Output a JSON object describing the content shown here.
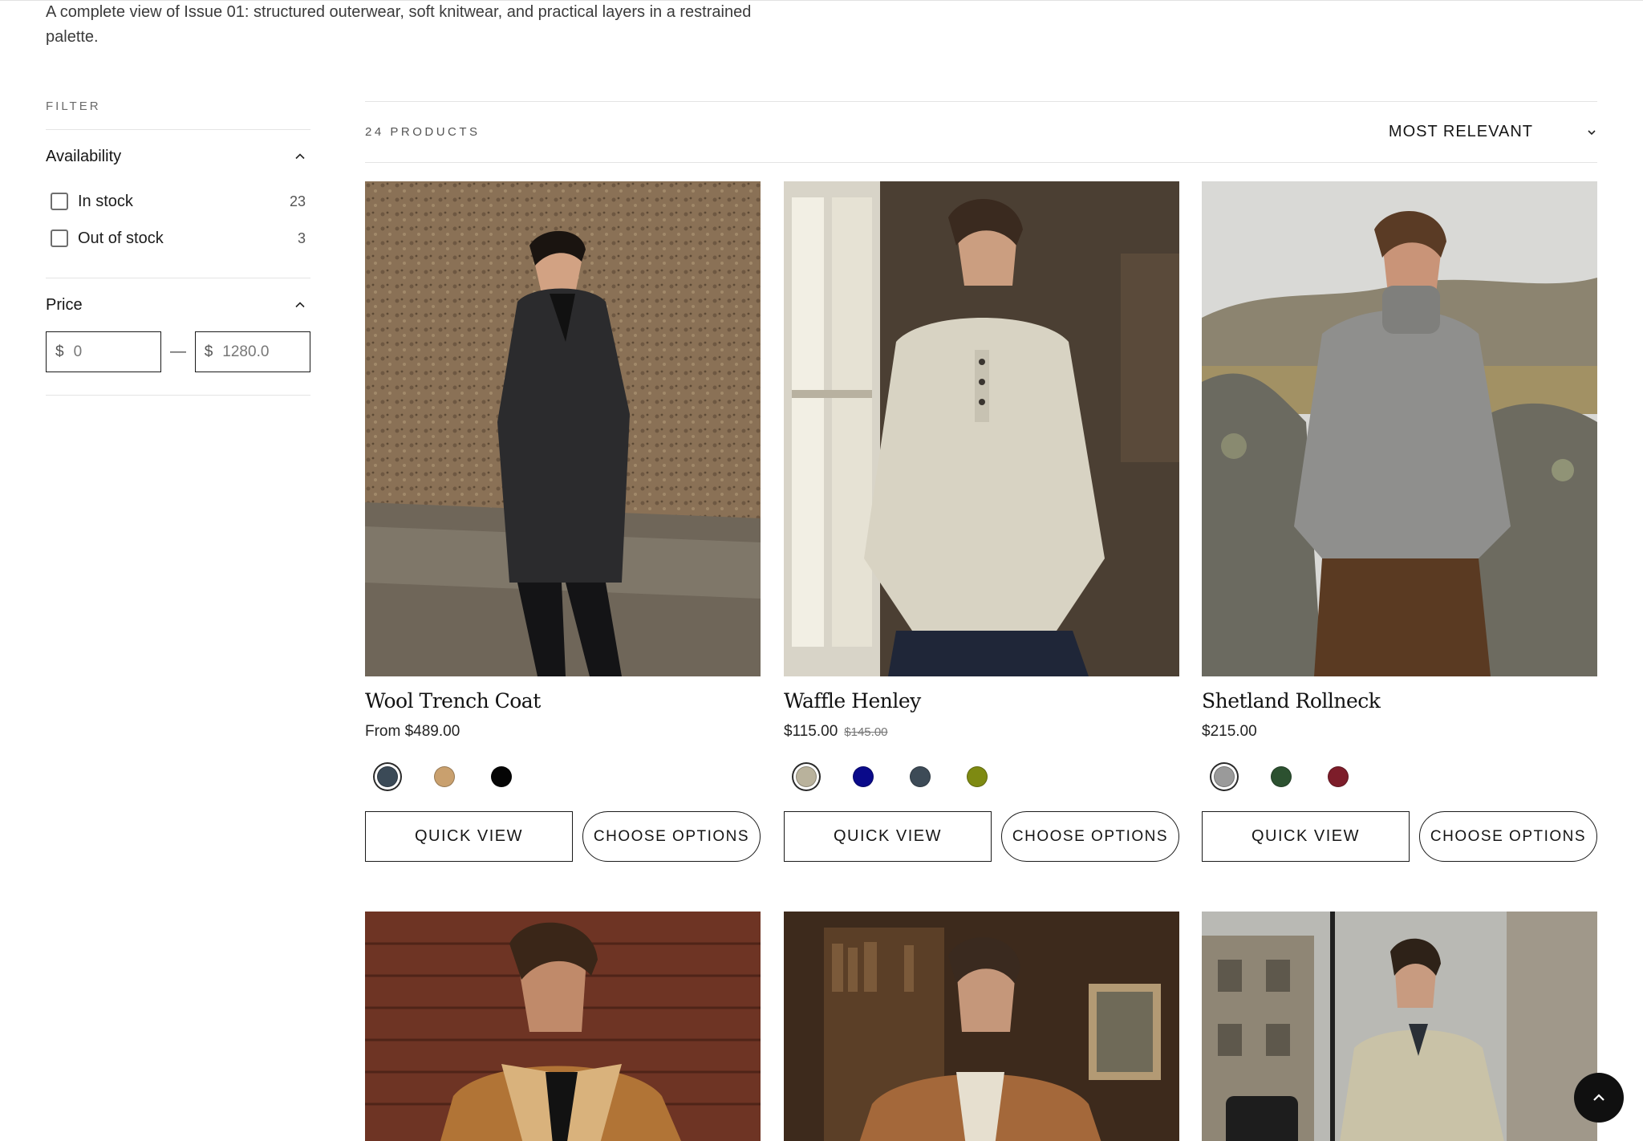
{
  "intro": {
    "text": "A complete view of Issue 01: structured outerwear, soft knitwear, and practical layers in a restrained palette."
  },
  "filter": {
    "title": "FILTER",
    "availability": {
      "label": "Availability",
      "options": [
        {
          "label": "In stock",
          "count": "23",
          "checked": false
        },
        {
          "label": "Out of stock",
          "count": "3",
          "checked": false
        }
      ]
    },
    "price": {
      "label": "Price",
      "currency": "$",
      "min_placeholder": "0",
      "max_placeholder": "1280.0",
      "separator": "—"
    }
  },
  "toolbar": {
    "count": "24 PRODUCTS",
    "sort_label": "MOST RELEVANT"
  },
  "products": [
    {
      "name": "Wool Trench Coat",
      "price": "From $489.00",
      "compare_price": "",
      "swatches": [
        "#3b4a57",
        "#c9a06e",
        "#050505"
      ],
      "selected_swatch": 0,
      "quick_view": "QUICK VIEW",
      "choose_options": "CHOOSE OPTIONS"
    },
    {
      "name": "Waffle Henley",
      "price": "$115.00",
      "compare_price": "$145.00",
      "swatches": [
        "#b9b29c",
        "#0a0a8a",
        "#3d4b57",
        "#7e8a12"
      ],
      "selected_swatch": 0,
      "quick_view": "QUICK VIEW",
      "choose_options": "CHOOSE OPTIONS"
    },
    {
      "name": "Shetland Rollneck",
      "price": "$215.00",
      "compare_price": "",
      "swatches": [
        "#9a9a9a",
        "#2c5130",
        "#7d1d2a"
      ],
      "selected_swatch": 0,
      "quick_view": "QUICK VIEW",
      "choose_options": "CHOOSE OPTIONS"
    }
  ],
  "colors": {
    "accent": "#111111",
    "border": "#e4e4e4"
  },
  "icons": {
    "scroll_top": "chevron-up-icon",
    "sort": "chevron-down-icon",
    "facet_toggle": "chevron-up-icon"
  }
}
